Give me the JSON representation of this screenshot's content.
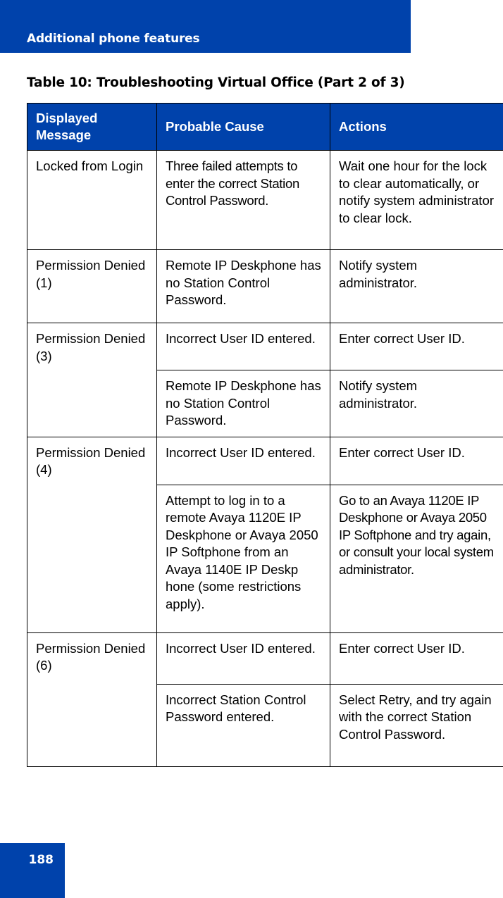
{
  "header": {
    "section_title": "Additional phone features"
  },
  "table": {
    "title": "Table 10: Troubleshooting Virtual Office (Part 2 of 3)",
    "columns": [
      "Displayed Message",
      "Probable Cause",
      "Actions"
    ],
    "groups": [
      {
        "message": "Locked from Login",
        "rows": [
          {
            "cause": "Three failed attempts to enter the correct Station Control Password.",
            "action": "Wait one hour for the lock to clear automatically, or notify system administrator to clear lock."
          }
        ]
      },
      {
        "message": "Permission Denied (1)",
        "rows": [
          {
            "cause": "Remote IP Deskphone has no Station Control Password.",
            "action": "Notify system administrator."
          }
        ]
      },
      {
        "message": "Permission Denied (3)",
        "rows": [
          {
            "cause": "Incorrect User ID entered.",
            "action": "Enter correct User ID."
          },
          {
            "cause": "Remote IP Deskphone has no Station Control Password.",
            "action": "Notify system administrator."
          }
        ]
      },
      {
        "message": "Permission Denied (4)",
        "rows": [
          {
            "cause": "Incorrect User ID entered.",
            "action": "Enter correct User ID."
          },
          {
            "cause": "Attempt to log in to a remote Avaya 1120E IP Deskphone  or Avaya 2050 IP Softphone from an Avaya 1140E IP Deskp hone (some restrictions apply).",
            "action": "Go to an Avaya 1120E IP Deskphone or Avaya 2050 IP Softphone and try again, or consult your local system administrator."
          }
        ]
      },
      {
        "message": "Permission Denied (6)",
        "rows": [
          {
            "cause": "Incorrect User ID entered.",
            "action": "Enter correct User ID."
          },
          {
            "cause": "Incorrect Station Control Password entered.",
            "action": "Select Retry, and try again with the correct Station Control Password."
          }
        ]
      }
    ]
  },
  "footer": {
    "page_number": "188"
  },
  "colors": {
    "brand_blue": "#0042ab"
  }
}
